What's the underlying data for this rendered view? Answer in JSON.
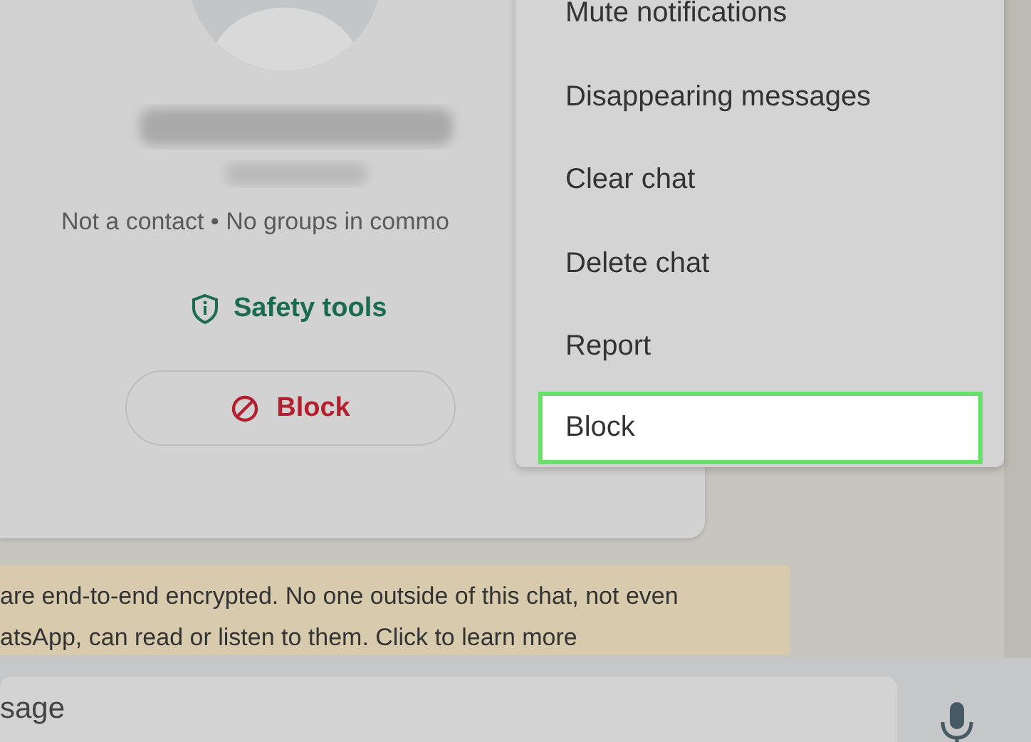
{
  "contact_card": {
    "subtitle": "Not a contact • No groups in commo",
    "safety_tools": "Safety tools",
    "block_button": "Block"
  },
  "menu": {
    "items": [
      {
        "label": "Mute notifications",
        "selected": false
      },
      {
        "label": "Disappearing messages",
        "selected": false
      },
      {
        "label": "Clear chat",
        "selected": false
      },
      {
        "label": "Delete chat",
        "selected": false
      },
      {
        "label": "Report",
        "selected": false
      },
      {
        "label": "Block",
        "selected": true
      }
    ]
  },
  "encryption_notice": {
    "lines": [
      "are end-to-end encrypted. No one outside of this chat, not even",
      "atsApp, can read or listen to them. Click to learn more"
    ]
  },
  "composer": {
    "placeholder": "sage"
  }
}
